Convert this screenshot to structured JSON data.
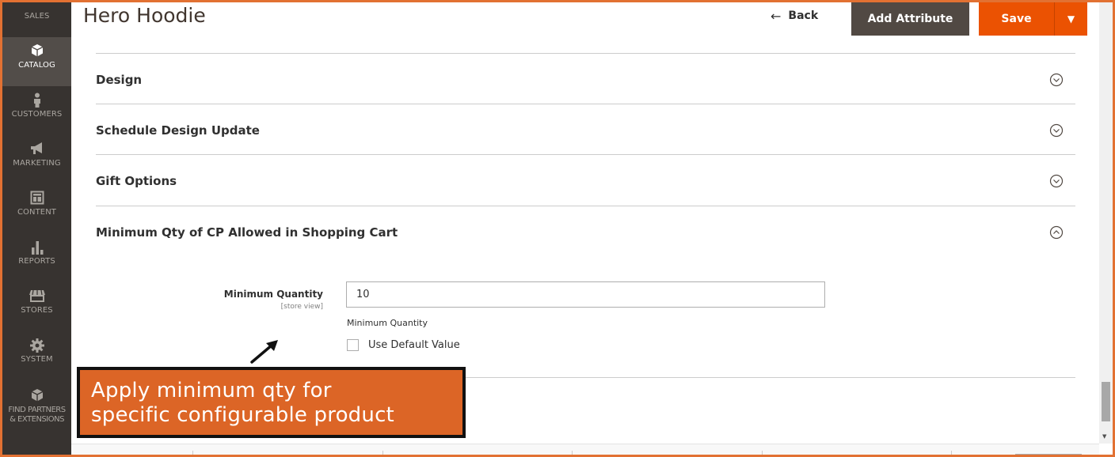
{
  "sidebar": {
    "items": [
      {
        "label": "SALES",
        "icon": "dollar-icon"
      },
      {
        "label": "CATALOG",
        "icon": "cube-icon"
      },
      {
        "label": "CUSTOMERS",
        "icon": "person-icon"
      },
      {
        "label": "MARKETING",
        "icon": "megaphone-icon"
      },
      {
        "label": "CONTENT",
        "icon": "layout-icon"
      },
      {
        "label": "REPORTS",
        "icon": "bar-chart-icon"
      },
      {
        "label": "STORES",
        "icon": "storefront-icon"
      },
      {
        "label": "SYSTEM",
        "icon": "gear-icon"
      },
      {
        "label_line1": "FIND PARTNERS",
        "label_line2": "& EXTENSIONS",
        "icon": "partners-cube-icon"
      }
    ],
    "active_item": "CATALOG"
  },
  "header": {
    "title": "Hero Hoodie",
    "back_label": "Back",
    "add_attribute_label": "Add Attribute",
    "save_label": "Save"
  },
  "sections": [
    {
      "title": "Design",
      "expanded": false
    },
    {
      "title": "Schedule Design Update",
      "expanded": false
    },
    {
      "title": "Gift Options",
      "expanded": false
    },
    {
      "title": "Minimum Qty of CP Allowed in Shopping Cart",
      "expanded": true
    }
  ],
  "min_qty": {
    "label": "Minimum Quantity",
    "scope": "[store view]",
    "value": "10",
    "note": "Minimum Quantity",
    "use_default_label": "Use Default Value",
    "use_default_checked": false
  },
  "annotation": {
    "line1": "Apply minimum qty for",
    "line2": "specific configurable product"
  },
  "colors": {
    "sidebar_bg": "#373330",
    "sidebar_active": "#524d49",
    "save_orange": "#eb5202",
    "add_attribute_bg": "#514943",
    "callout_bg": "#dc6526",
    "frame_border": "#e27132"
  }
}
